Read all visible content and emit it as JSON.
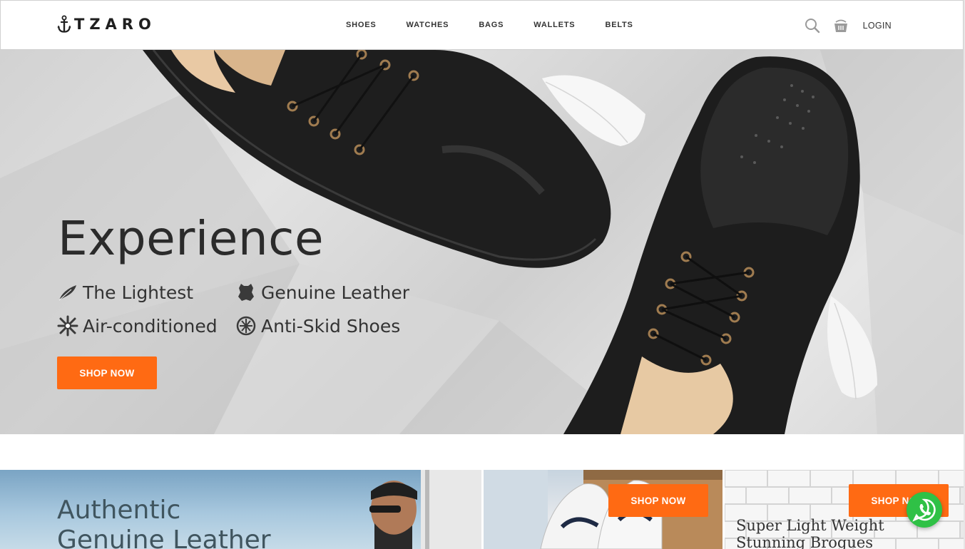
{
  "brand": {
    "name": "TZARO",
    "logo_icon": "anchor-icon"
  },
  "nav": {
    "items": [
      "SHOES",
      "WATCHES",
      "BAGS",
      "WALLETS",
      "BELTS"
    ]
  },
  "header_right": {
    "search_icon": "search-icon",
    "cart_icon": "basket-icon",
    "login_label": "LOGIN"
  },
  "hero": {
    "title": "Experience",
    "features": [
      {
        "label": "The Lightest",
        "icon": "feather-icon"
      },
      {
        "label": "Genuine Leather",
        "icon": "leather-hide-icon"
      },
      {
        "label": "Air-conditioned",
        "icon": "snowflake-icon"
      },
      {
        "label": "Anti-Skid Shoes",
        "icon": "anti-skid-icon"
      }
    ],
    "cta_label": "SHOP NOW"
  },
  "promos": [
    {
      "title_line1": "Authentic",
      "title_line2": "Genuine Leather"
    },
    {
      "cta_label": "SHOP NOW"
    },
    {
      "cta_label": "SHOP NOW",
      "title_line1": "Super Light Weight",
      "title_line2": "Stunning Brogues"
    }
  ],
  "colors": {
    "accent": "#ff6a13",
    "whatsapp": "#2fc146",
    "text_dark": "#2b2b2b"
  },
  "floating": {
    "whatsapp_icon": "whatsapp-icon"
  }
}
